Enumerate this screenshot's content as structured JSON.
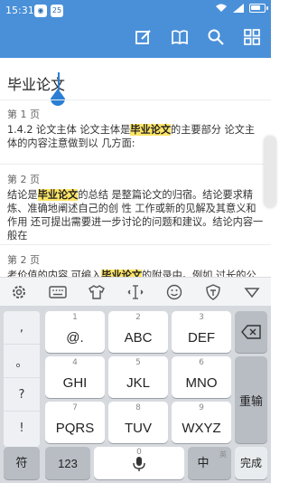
{
  "status": {
    "time": "15:31",
    "badge1": "◉",
    "badge2": "25",
    "battery_level": 0.8
  },
  "toolbar": {
    "icons": [
      "edit-icon",
      "book-icon",
      "search-icon",
      "grid-icon"
    ]
  },
  "search": {
    "query": "毕业论文"
  },
  "results": [
    {
      "page": "第 1 页",
      "before": "1.4.2 论文主体 论文主体是",
      "highlight": "毕业论文",
      "after": "的主要部分 论文主体的内容注意做到以 几方面:"
    },
    {
      "page": "第 2 页",
      "before": "结论是",
      "highlight": "毕业论文",
      "after": "的总结 是整篇论文的归宿。结论要求精炼、准确地阐述自己的创 性 工作或新的见解及其意义和作用 还可提出需要进一步讨论的问题和建议。结论内容一般在"
    },
    {
      "page": "第 2 页",
      "before": "考价值的内容 可编入",
      "highlight": "毕业论文",
      "after": "的附录中。例如 过长的公式推导、重 性的数据、图表、程序全文及其说明等。"
    }
  ],
  "keyboard": {
    "toolbar": [
      "settings-icon",
      "keyboard-icon",
      "shirt-icon",
      "cursor-move-icon",
      "emoji-icon",
      "shield-icon",
      "collapse-icon"
    ],
    "side_keys": [
      ",",
      "。",
      "?",
      "!"
    ],
    "rows": [
      [
        {
          "num": "1",
          "label": "@."
        },
        {
          "num": "2",
          "label": "ABC"
        },
        {
          "num": "3",
          "label": "DEF"
        }
      ],
      [
        {
          "num": "4",
          "label": "GHI"
        },
        {
          "num": "5",
          "label": "JKL"
        },
        {
          "num": "6",
          "label": "MNO"
        }
      ],
      [
        {
          "num": "7",
          "label": "PQRS"
        },
        {
          "num": "8",
          "label": "TUV"
        },
        {
          "num": "9",
          "label": "WXYZ"
        }
      ]
    ],
    "delete": "⌫",
    "retype": "重输",
    "bottom": {
      "symbol": "符",
      "num": "123",
      "zero": "0",
      "lang": "中",
      "lang_alt": "英",
      "done": "完成"
    }
  }
}
